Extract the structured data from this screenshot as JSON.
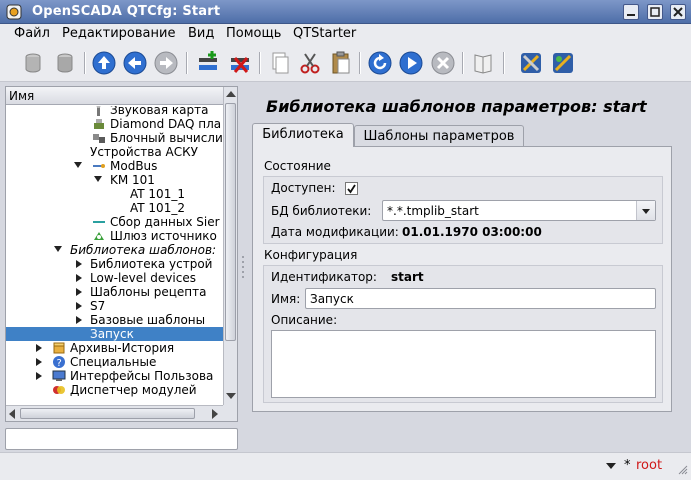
{
  "window": {
    "title": "OpenSCADA QTCfg: Start"
  },
  "menu": [
    "Файл",
    "Редактирование",
    "Вид",
    "Помощь",
    "QTStarter"
  ],
  "tree": {
    "header": "Имя",
    "rows": [
      {
        "label": "Звуковая карта",
        "icon": "sound-card-icon"
      },
      {
        "label": "Diamond DAQ пла",
        "icon": "daq-board-icon"
      },
      {
        "label": "Блочный вычисли",
        "icon": "block-calc-icon"
      },
      {
        "label": "Устройства АСКУ",
        "icon": ""
      },
      {
        "label": "ModBus",
        "icon": "modbus-icon"
      },
      {
        "label": "KM 101",
        "icon": ""
      },
      {
        "label": "AT 101_1",
        "icon": ""
      },
      {
        "label": "AT 101_2",
        "icon": ""
      },
      {
        "label": "Сбор данных Sier",
        "icon": "siemens-icon"
      },
      {
        "label": "Шлюз источнико",
        "icon": "gateway-icon"
      },
      {
        "label": "Библиотека шаблонов:",
        "icon": ""
      },
      {
        "label": "Библиотека устрой",
        "icon": ""
      },
      {
        "label": "Low-level devices",
        "icon": ""
      },
      {
        "label": "Шаблоны рецепта",
        "icon": ""
      },
      {
        "label": "S7",
        "icon": ""
      },
      {
        "label": "Базовые шаблоны",
        "icon": ""
      },
      {
        "label": "Запуск",
        "icon": ""
      },
      {
        "label": "Архивы-История",
        "icon": "archive-icon"
      },
      {
        "label": "Специальные",
        "icon": "special-icon"
      },
      {
        "label": "Интерфейсы Пользова",
        "icon": "ui-icon"
      },
      {
        "label": "Диспетчер модулей",
        "icon": "modules-icon"
      }
    ]
  },
  "main": {
    "title": "Библиотека шаблонов параметров: start",
    "tabs": [
      "Библиотека",
      "Шаблоны параметров"
    ],
    "state": {
      "title": "Состояние",
      "enabled_label": "Доступен:",
      "enabled": true,
      "db_label": "БД библиотеки:",
      "db_value": "*.*.tmplib_start",
      "modified_label": "Дата модификации:",
      "modified_value": "01.01.1970 03:00:00"
    },
    "config": {
      "title": "Конфигурация",
      "id_label": "Идентификатор:",
      "id_value": "start",
      "name_label": "Имя:",
      "name_value": "Запуск",
      "descr_label": "Описание:",
      "descr_value": ""
    }
  },
  "status": {
    "modified_mark": "*",
    "user": "root"
  },
  "colors": {
    "selection": "#3f81c6",
    "title_bar": "#5b7bb5",
    "user": "#d01818"
  }
}
